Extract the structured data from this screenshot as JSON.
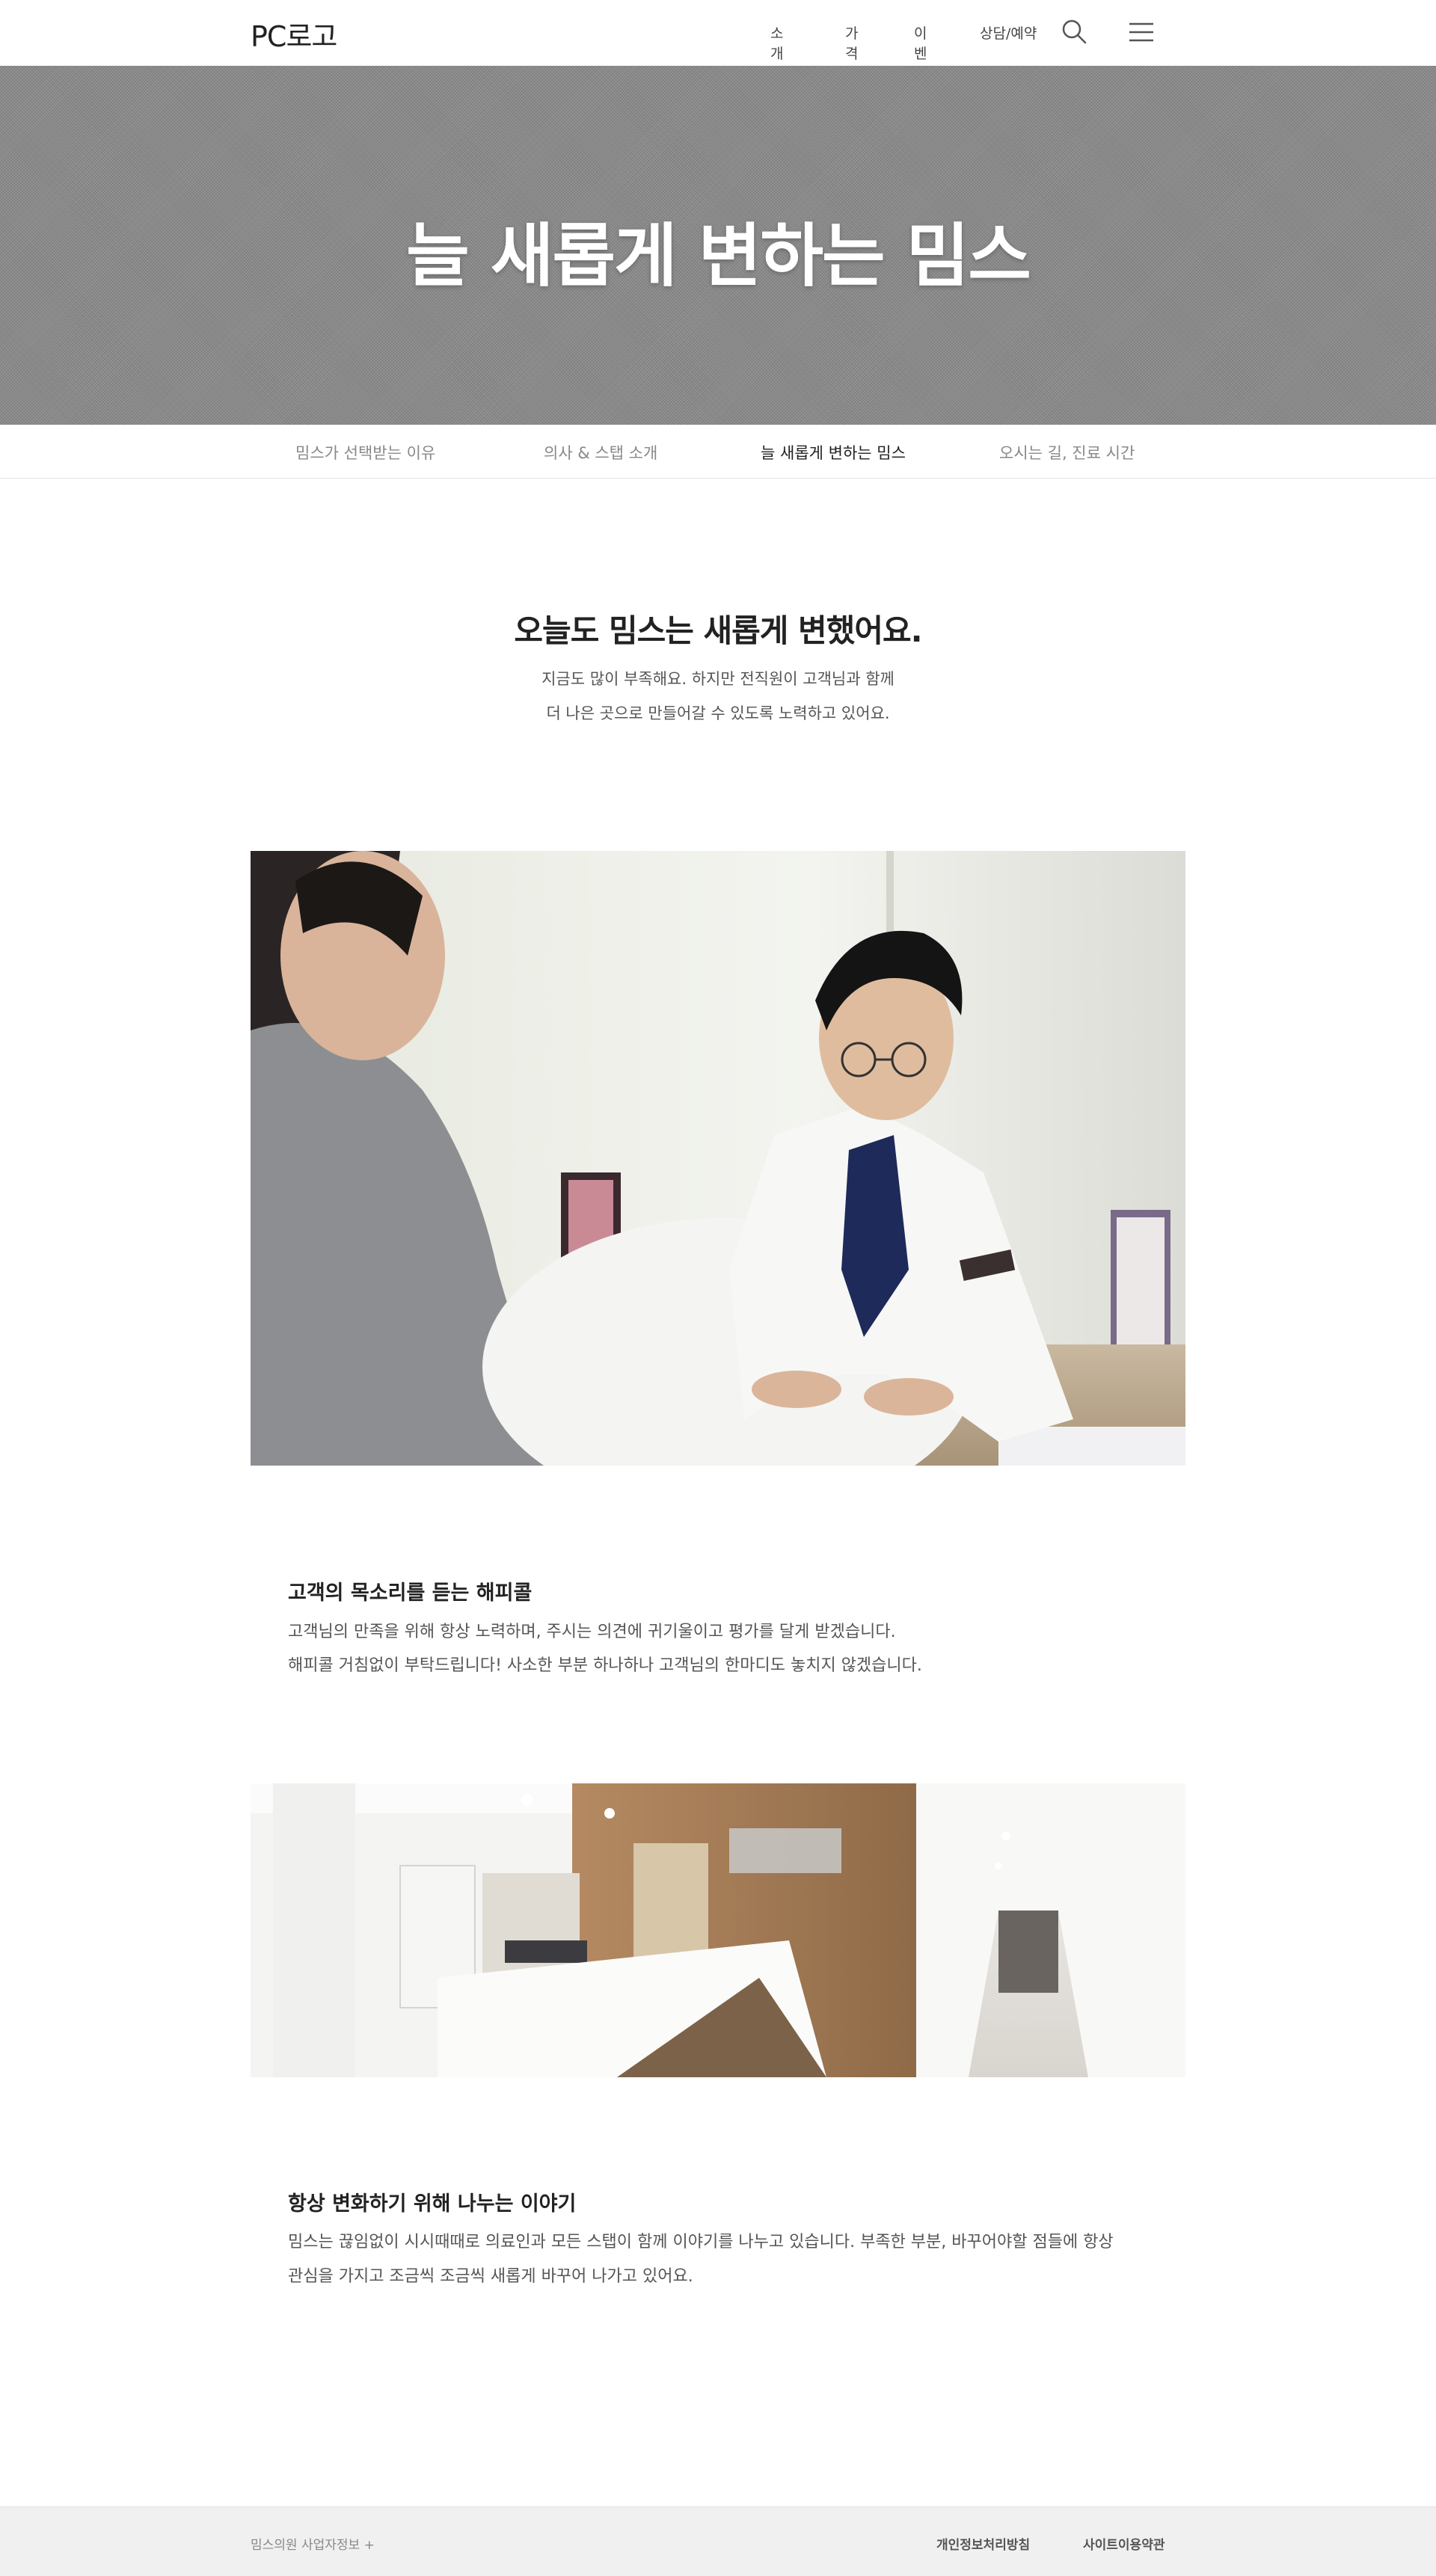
{
  "header": {
    "logo": "PC로고",
    "nav": [
      "소개",
      "가격",
      "이벤트",
      "상담/예약"
    ],
    "icons": [
      "search-icon",
      "menu-icon"
    ]
  },
  "hero": {
    "title": "늘 새롭게 변하는 밈스"
  },
  "subnav": {
    "items": [
      "밈스가 선택받는 이유",
      "의사 & 스탭 소개",
      "늘 새롭게 변하는 밈스",
      "오시는 길, 진료 시간"
    ],
    "active_index": 2
  },
  "intro": {
    "title": "오늘도 밈스는 새롭게 변했어요.",
    "lines": [
      "지금도 많이 부족해요. 하지만 전직원이 고객님과 함께",
      "더 나은 곳으로 만들어갈 수 있도록 노력하고 있어요."
    ]
  },
  "sections": [
    {
      "title": "고객의 목소리를 듣는 해피콜",
      "lines": [
        "고객님의 만족을 위해 항상 노력하며, 주시는 의견에 귀기울이고 평가를 달게 받겠습니다.",
        "해피콜 거침없이 부탁드립니다! 사소한 부분 하나하나 고객님의 한마디도 놓치지 않겠습니다."
      ]
    },
    {
      "title": "항상 변화하기 위해 나누는 이야기",
      "lines": [
        "밈스는 끊임없이 시시때때로 의료인과 모든 스탭이 함께 이야기를 나누고 있습니다. 부족한 부분, 바꾸어야할 점들에 항상",
        "관심을 가지고 조금씩 조금씩 새롭게 바꾸어 나가고 있어요."
      ]
    }
  ],
  "footer": {
    "info": "밈스의원 사업자정보 +",
    "links": [
      "개인정보처리방침",
      "사이트이용약관"
    ]
  },
  "colors": {
    "hero_bg": "#8a8a8a",
    "footer_bg": "#f0f0f0",
    "text_dark": "#222222",
    "text_muted": "#888888"
  }
}
